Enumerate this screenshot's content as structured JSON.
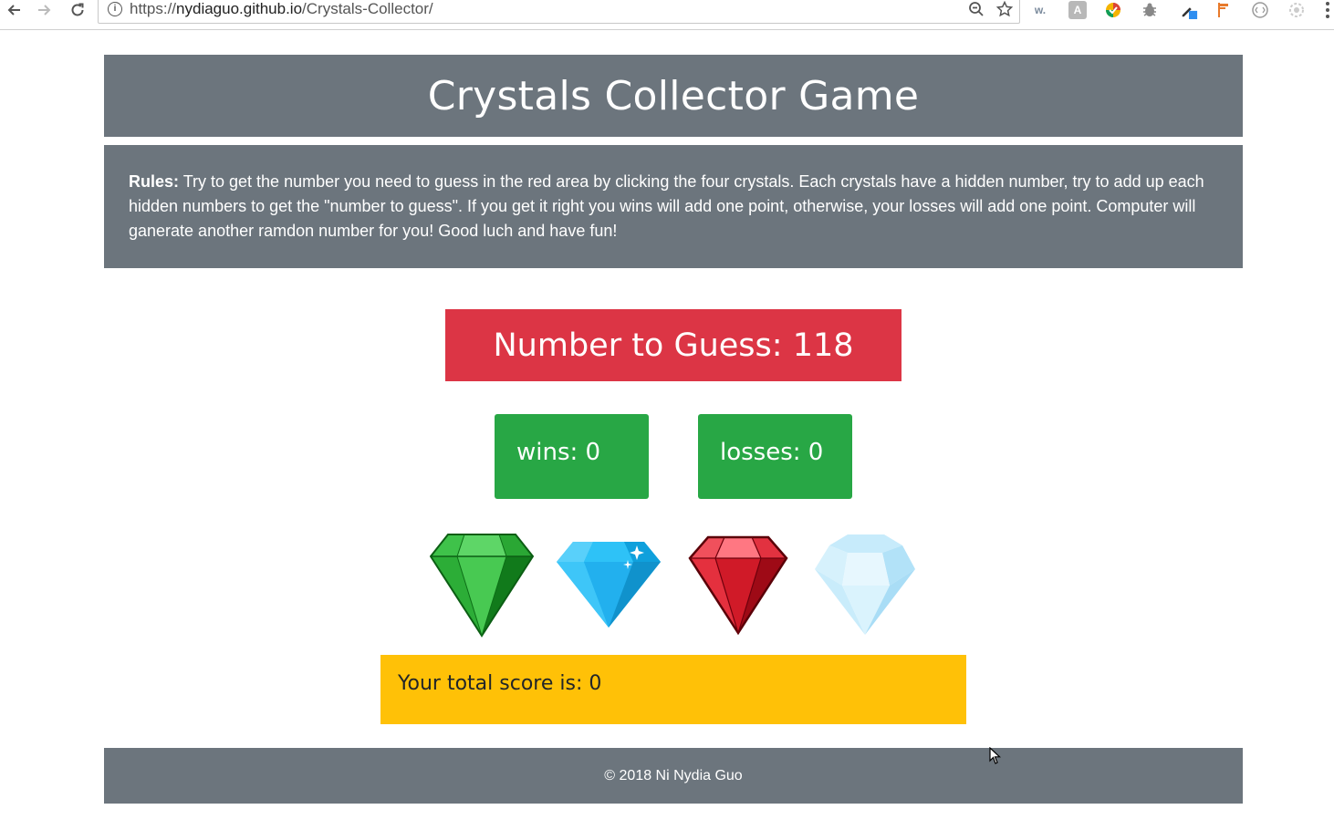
{
  "browser": {
    "url_scheme": "https://",
    "url_host": "nydiaguo.github.io",
    "url_path": "/Crystals-Collector/",
    "extensions": [
      "w.",
      "A"
    ]
  },
  "page": {
    "title": "Crystals Collector Game",
    "rules_label": "Rules:",
    "rules_text": " Try to get the number you need to guess in the red area by clicking the four crystals. Each crystals have a hidden number, try to add up each hidden numbers to get the \"number to guess\". If you get it right you wins will add one point, otherwise, your losses will add one point. Computer will ganerate another ramdon number for you! Good luch and have fun!",
    "guess_label": "Number to Guess: 118",
    "wins_label": "wins: 0",
    "losses_label": "losses: 0",
    "score_label": "Your total score is: 0",
    "footer_text": "© 2018 Ni Nydia Guo"
  },
  "crystals": [
    {
      "name": "green-crystal",
      "color": "#1e9e2a"
    },
    {
      "name": "blue-crystal",
      "color": "#1eb4f0"
    },
    {
      "name": "red-crystal",
      "color": "#d81c2c"
    },
    {
      "name": "clear-crystal",
      "color": "#bfe6fa"
    }
  ],
  "colors": {
    "header_bg": "#6c757d",
    "guess_bg": "#dc3545",
    "stat_bg": "#28a745",
    "score_bg": "#ffc107"
  }
}
